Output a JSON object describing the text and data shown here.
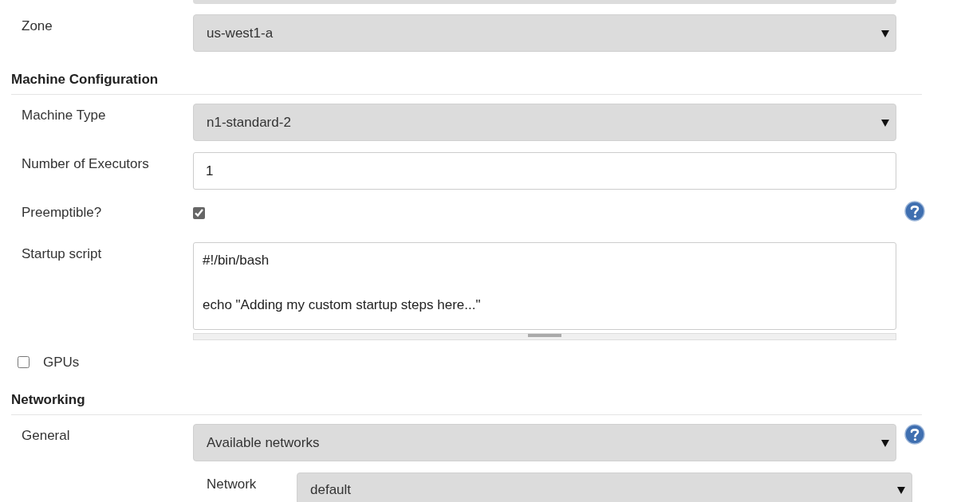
{
  "items": [
    {
      "kind": "select-stub"
    },
    {
      "kind": "select",
      "label": "Zone",
      "value": "us-west1-a",
      "help": false
    },
    {
      "kind": "heading",
      "title": "Machine Configuration"
    },
    {
      "kind": "select",
      "label": "Machine Type",
      "value": "n1-standard-2",
      "help": false
    },
    {
      "kind": "input",
      "label": "Number of Executors",
      "value": "1",
      "help": false
    },
    {
      "kind": "checkbox",
      "label": "Preemptible?",
      "checked": true,
      "help": true
    },
    {
      "kind": "textarea",
      "label": "Startup script",
      "value": "#!/bin/bash\n\necho \"Adding my custom startup steps here...\"",
      "help": false
    },
    {
      "kind": "optional-block",
      "label": "GPUs",
      "checked": false
    },
    {
      "kind": "heading",
      "title": "Networking"
    },
    {
      "kind": "select",
      "label": "General",
      "value": "Available networks",
      "help": true
    },
    {
      "kind": "nested-select",
      "label": "Network",
      "value": "default"
    }
  ]
}
